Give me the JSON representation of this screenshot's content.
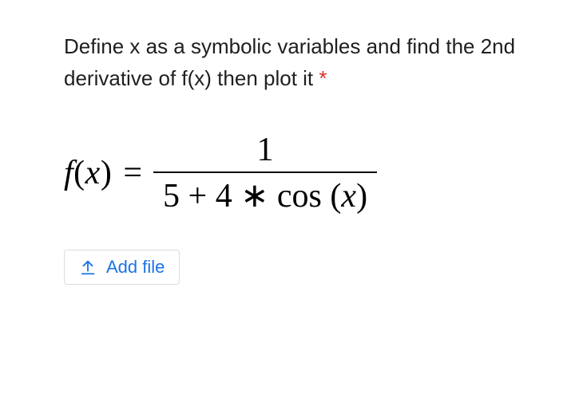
{
  "question": {
    "text": "Define x as a symbolic variables and find the 2nd derivative of f(x) then plot it",
    "required_mark": "*"
  },
  "formula": {
    "lhs": "f(x)",
    "eq": "=",
    "numerator": "1",
    "denominator": "5 + 4 * cos (x)"
  },
  "upload": {
    "label": "Add file",
    "icon": "upload-icon"
  }
}
